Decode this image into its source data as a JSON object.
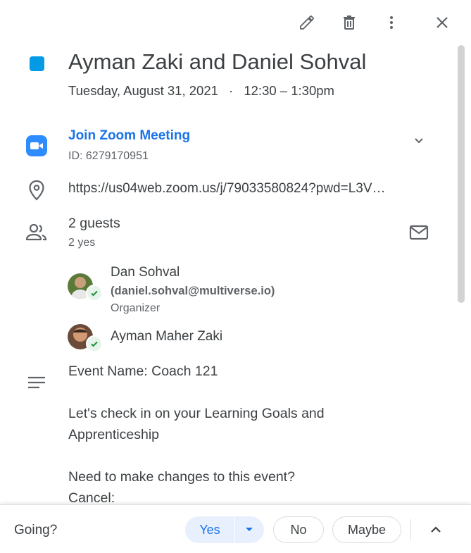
{
  "toolbar": {
    "edit_icon": "pencil-icon",
    "delete_icon": "trash-icon",
    "more_icon": "more-vert-icon",
    "close_icon": "close-icon"
  },
  "event": {
    "color": "#039be5",
    "title": "Ayman Zaki and Daniel Sohval",
    "date": "Tuesday, August 31, 2021",
    "separator": "·",
    "time": "12:30 – 1:30pm"
  },
  "conference": {
    "join_label": "Join Zoom Meeting",
    "meeting_id": "ID: 6279170951"
  },
  "location": {
    "url": "https://us04web.zoom.us/j/79033580824?pwd=L3V…"
  },
  "guests": {
    "count_label": "2 guests",
    "summary": "2 yes",
    "list": [
      {
        "name": "Dan Sohval",
        "email": "(daniel.sohval@multiverse.io)",
        "role": "Organizer"
      },
      {
        "name": "Ayman Maher Zaki"
      }
    ]
  },
  "description": {
    "line1": "Event Name: Coach 121",
    "line2": "Let's check in on your Learning Goals and\nApprenticeship",
    "line3": "Need to make changes to this event?",
    "line4": "Cancel:"
  },
  "footer": {
    "going_label": "Going?",
    "yes_label": "Yes",
    "no_label": "No",
    "maybe_label": "Maybe"
  },
  "colors": {
    "accent": "#1a73e8",
    "zoom_blue": "#2d8cff",
    "check_green": "#1e8e3e"
  }
}
